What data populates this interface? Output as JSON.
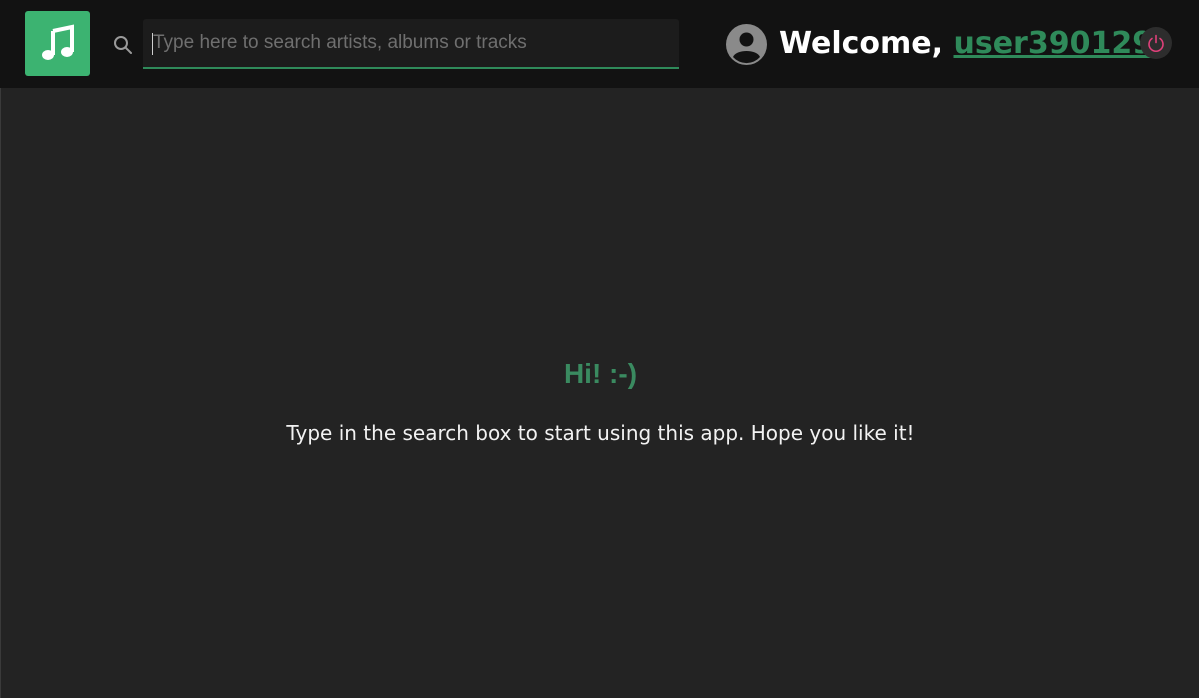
{
  "header": {
    "logo_icon": "music-note-icon",
    "search": {
      "icon": "search-icon",
      "placeholder": "Type here to search artists, albums or tracks",
      "value": ""
    },
    "user": {
      "avatar_icon": "user-avatar-icon",
      "welcome_prefix": "Welcome, ",
      "username": "user390129",
      "welcome_suffix": "!"
    },
    "logout_icon": "power-icon"
  },
  "main": {
    "greeting": "Hi! :-)",
    "hint": "Type in the search box to start using this app. Hope you like it!"
  },
  "colors": {
    "accent": "#3cb371",
    "accent_dark": "#2f8a5a",
    "header_bg": "#121212",
    "page_bg": "#232323",
    "logout": "#e0407a"
  }
}
